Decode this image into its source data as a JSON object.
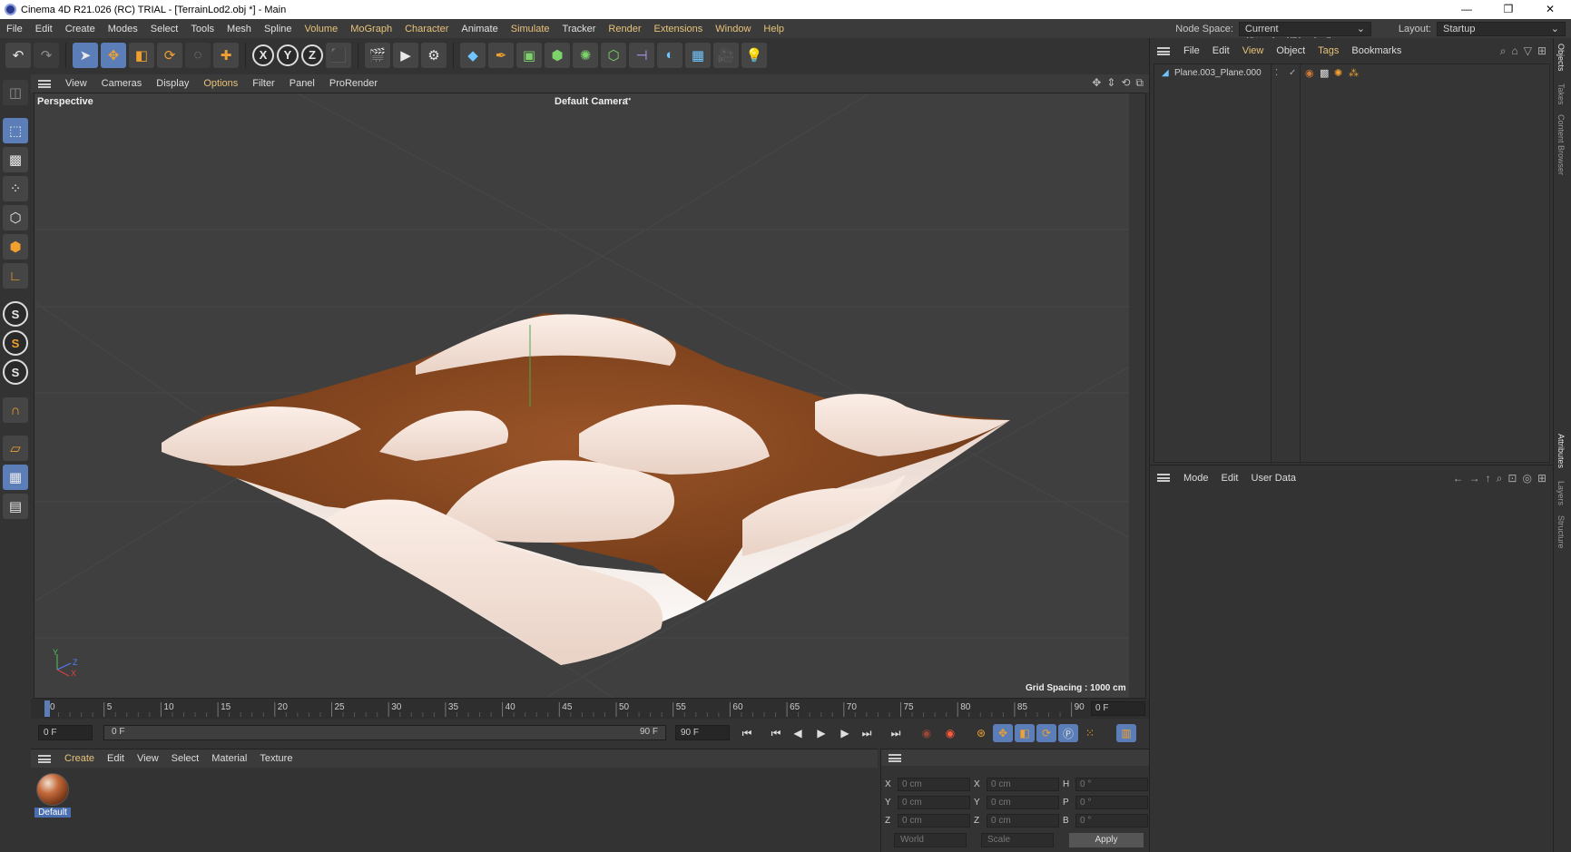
{
  "window": {
    "title": "Cinema 4D R21.026 (RC) TRIAL - [TerrainLod2.obj *] - Main",
    "minimize": "—",
    "restore": "❐",
    "close": "✕"
  },
  "menubar": {
    "items": [
      "File",
      "Edit",
      "Create",
      "Modes",
      "Select",
      "Tools",
      "Mesh",
      "Spline",
      "Volume",
      "MoGraph",
      "Character",
      "Animate",
      "Simulate",
      "Tracker",
      "Render",
      "Extensions",
      "Window",
      "Help"
    ],
    "node_space_label": "Node Space:",
    "node_space_value": "Current (Standard/Physical)",
    "layout_label": "Layout:",
    "layout_value": "Startup"
  },
  "viewport_menu": {
    "items": [
      "View",
      "Cameras",
      "Display",
      "Options",
      "Filter",
      "Panel",
      "ProRender"
    ]
  },
  "viewport": {
    "view_name": "Perspective",
    "camera": "Default Camera",
    "camera_icon": "••",
    "grid_spacing": "Grid Spacing : 1000 cm",
    "axis_y": "Y",
    "axis_z": "Z",
    "axis_x": "X"
  },
  "timeline": {
    "ticks": [
      "0",
      "5",
      "10",
      "15",
      "20",
      "25",
      "30",
      "35",
      "40",
      "45",
      "50",
      "55",
      "60",
      "65",
      "70",
      "75",
      "80",
      "85",
      "90"
    ],
    "current_frame": "0 F"
  },
  "transport": {
    "start_field": "0 F",
    "range_start": "0 F",
    "range_end": "90 F",
    "end_field": "90 F"
  },
  "material_manager": {
    "menu": [
      "Create",
      "Edit",
      "View",
      "Select",
      "Material",
      "Texture"
    ],
    "materials": [
      {
        "name": "Default"
      }
    ]
  },
  "coordinates": {
    "rows": [
      {
        "a1": "X",
        "v1": "0 cm",
        "a2": "X",
        "v2": "0 cm",
        "a3": "H",
        "v3": "0 °"
      },
      {
        "a1": "Y",
        "v1": "0 cm",
        "a2": "Y",
        "v2": "0 cm",
        "a3": "P",
        "v3": "0 °"
      },
      {
        "a1": "Z",
        "v1": "0 cm",
        "a2": "Z",
        "v2": "0 cm",
        "a3": "B",
        "v3": "0 °"
      }
    ],
    "space": "World",
    "mode": "Scale",
    "apply": "Apply"
  },
  "object_manager": {
    "menu": [
      "File",
      "Edit",
      "View",
      "Object",
      "Tags",
      "Bookmarks"
    ],
    "objects": [
      {
        "name": "Plane.003_Plane.000"
      }
    ]
  },
  "attribute_manager": {
    "menu": [
      "Mode",
      "Edit",
      "User Data"
    ]
  },
  "side_tabs": [
    "Objects",
    "Takes",
    "Content Browser",
    "Attributes",
    "Layers",
    "Structure"
  ],
  "colors": {
    "accent": "#5b7db8",
    "highlight_text": "#e8c37a",
    "terrain_brown": "#8a4a22"
  }
}
